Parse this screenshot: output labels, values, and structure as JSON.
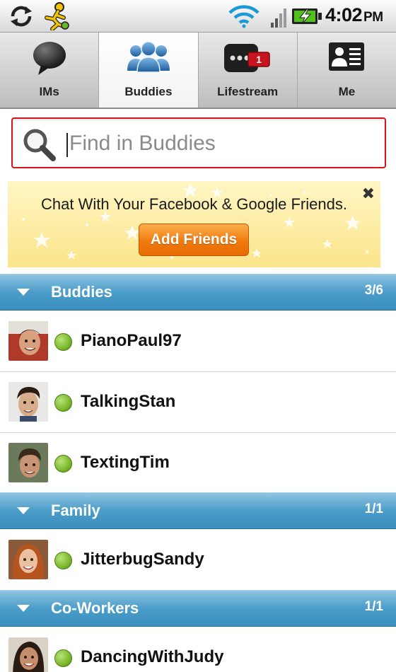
{
  "status_bar": {
    "time": "4:02",
    "ampm": "PM",
    "icons": [
      "sync-icon",
      "aim-runner-icon",
      "wifi-icon",
      "signal-icon",
      "battery-charging-icon"
    ]
  },
  "tabs": [
    {
      "label": "IMs",
      "icon": "speech-bubble-icon",
      "active": false
    },
    {
      "label": "Buddies",
      "icon": "buddies-group-icon",
      "active": true
    },
    {
      "label": "Lifestream",
      "icon": "lifestream-icon",
      "active": false,
      "badge": "1"
    },
    {
      "label": "Me",
      "icon": "profile-card-icon",
      "active": false
    }
  ],
  "search": {
    "placeholder": "Find in Buddies",
    "value": ""
  },
  "promo": {
    "text": "Chat With Your Facebook & Google Friends.",
    "button_label": "Add Friends",
    "close_symbol": "✖"
  },
  "groups": [
    {
      "name": "Buddies",
      "count": "3/6",
      "buddies": [
        {
          "name": "PianoPaul97",
          "status": "online"
        },
        {
          "name": "TalkingStan",
          "status": "online"
        },
        {
          "name": "TextingTim",
          "status": "online"
        }
      ]
    },
    {
      "name": "Family",
      "count": "1/1",
      "buddies": [
        {
          "name": "JitterbugSandy",
          "status": "online"
        }
      ]
    },
    {
      "name": "Co-Workers",
      "count": "1/1",
      "buddies": [
        {
          "name": "DancingWithJudy",
          "status": "online"
        }
      ]
    }
  ],
  "colors": {
    "group_header": "#4b9dc9",
    "online": "#7cb92c",
    "search_border": "#d4131f",
    "button_orange": "#f07a0e",
    "badge_red": "#c8141c"
  }
}
